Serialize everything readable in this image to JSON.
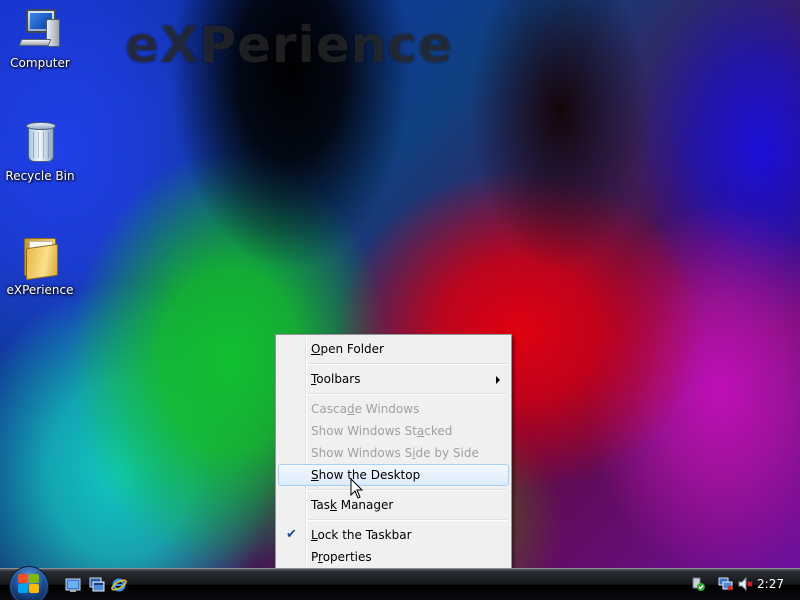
{
  "desktop": {
    "watermark_text": "eXPerience",
    "icons": [
      {
        "label": "Computer",
        "icon": "computer-icon"
      },
      {
        "label": "Recycle Bin",
        "icon": "recycle-bin-icon"
      },
      {
        "label": "eXPerience",
        "icon": "folder-icon"
      }
    ]
  },
  "context_menu": {
    "items": [
      {
        "pre": "",
        "acc": "O",
        "post": "pen Folder",
        "state": "enabled"
      },
      {
        "pre": "",
        "acc": "T",
        "post": "oolbars",
        "state": "enabled",
        "submenu": true
      },
      {
        "pre": "Casca",
        "acc": "d",
        "post": "e Windows",
        "state": "disabled"
      },
      {
        "pre": "Show Windows St",
        "acc": "a",
        "post": "cked",
        "state": "disabled"
      },
      {
        "pre": "Show Windows S",
        "acc": "i",
        "post": "de by Side",
        "state": "disabled"
      },
      {
        "pre": "",
        "acc": "S",
        "post": "how the Desktop",
        "state": "highlighted"
      },
      {
        "pre": "Tas",
        "acc": "k",
        "post": " Manager",
        "state": "enabled"
      },
      {
        "pre": "",
        "acc": "L",
        "post": "ock the Taskbar",
        "state": "checked"
      },
      {
        "pre": "P",
        "acc": "r",
        "post": "operties",
        "state": "enabled"
      }
    ]
  },
  "taskbar": {
    "clock": "2:27",
    "quick_launch": [
      "show-desktop-icon",
      "switch-windows-icon",
      "internet-explorer-icon"
    ],
    "tray": [
      "windows-update-icon",
      "network-icon",
      "volume-muted-icon"
    ]
  },
  "colors": {
    "menu_bg": "#f0f0f0",
    "menu_highlight": "#dcebfb",
    "disabled_text": "#a0a0a0",
    "taskbar": "#14161a"
  }
}
